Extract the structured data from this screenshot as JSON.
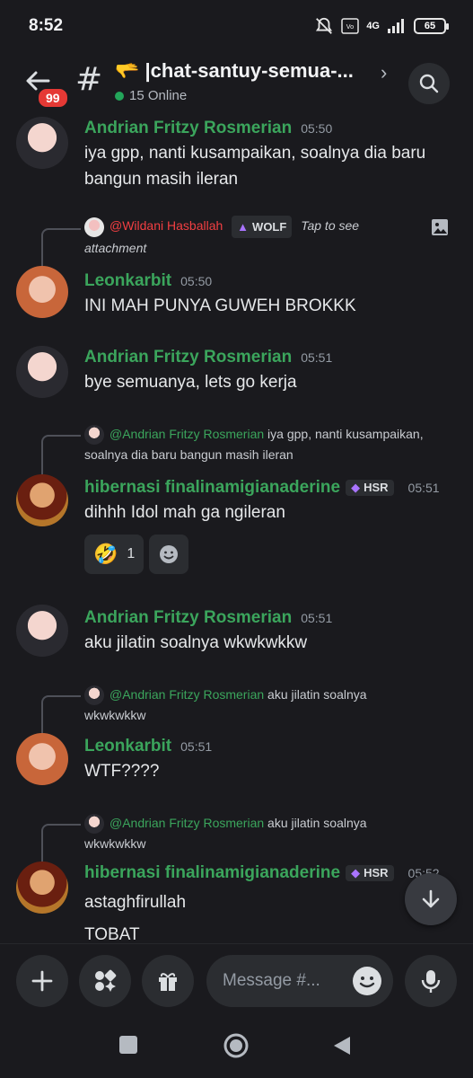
{
  "status": {
    "time": "8:52",
    "network": "4G",
    "battery": "65"
  },
  "header": {
    "back_badge": "99",
    "channel_emoji": "🫳",
    "channel_name": "|chat-santuy-semua-...",
    "online": "15 Online"
  },
  "messages": [
    {
      "author": "Andrian Fritzy Rosmerian",
      "time": "05:50",
      "lines": [
        "iya gpp, nanti kusampaikan, soalnya dia baru",
        "bangun masih ileran"
      ]
    },
    {
      "reply_to": "@Wildani Hasballah",
      "reply_tag": "WOLF",
      "reply_text_1": "Tap to see",
      "reply_text_2": "attachment",
      "author": "Leonkarbit",
      "time": "05:50",
      "text": "INI MAH PUNYA GUWEH BROKKK"
    },
    {
      "author": "Andrian Fritzy Rosmerian",
      "time": "05:51",
      "text": "bye semuanya, lets go kerja"
    },
    {
      "reply_to": "@Andrian Fritzy Rosmerian",
      "reply_text_1": "iya gpp, nanti kusampaikan,",
      "reply_text_2": "soalnya dia baru bangun masih ileran",
      "author": "hibernasi finalinamigianaderine",
      "tag": "HSR",
      "time": "05:51",
      "text": "dihhh Idol mah ga ngileran",
      "reaction_emoji": "🤣",
      "reaction_count": "1"
    },
    {
      "author": "Andrian Fritzy Rosmerian",
      "time": "05:51",
      "text": "aku jilatin soalnya wkwkwkkw"
    },
    {
      "reply_to": "@Andrian Fritzy Rosmerian",
      "reply_text_1": "aku jilatin soalnya",
      "reply_text_2": "wkwkwkkw",
      "author": "Leonkarbit",
      "time": "05:51",
      "text": "WTF????"
    },
    {
      "reply_to": "@Andrian Fritzy Rosmerian",
      "reply_text_1": "aku jilatin soalnya",
      "reply_text_2": "wkwkwkkw",
      "author": "hibernasi finalinamigianaderine",
      "tag": "HSR",
      "time": "05:52",
      "lines": [
        "astaghfirullah",
        "TOBAT"
      ]
    }
  ],
  "composer": {
    "placeholder": "Message #..."
  },
  "colors": {
    "bg": "#1a1a1e",
    "username": "#3ba55c",
    "mention_red": "#f23f42",
    "badge": "#e53935"
  }
}
